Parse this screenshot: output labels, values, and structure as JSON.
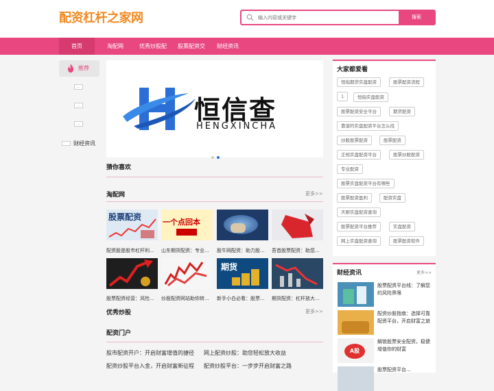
{
  "header": {
    "logo": "配资杠杆之家网",
    "search_placeholder": "输入内容或关键字",
    "search_button": "搜索"
  },
  "nav": {
    "items": [
      "首页",
      "淘配网",
      "优秀炒股配",
      "股票配资交",
      "财经资讯"
    ]
  },
  "left": {
    "recommend": "推荐",
    "dots": [
      "...",
      "...",
      "..."
    ],
    "finance": "财经资讯"
  },
  "banner": {
    "brand_cn": "恒信查",
    "brand_en": "HENGXINCHA"
  },
  "main": {
    "guess_title": "猜你喜欢",
    "tao_title": "淘配网",
    "tao_more": "更多>>",
    "grid_row1": [
      {
        "caption": "配资股是股市杠杆利...",
        "img_text": "股票配资"
      },
      {
        "caption": "山东期货配资：专业...",
        "img_text": "一个点回本"
      },
      {
        "caption": "股牛网配资：助力股...",
        "img_text": ""
      },
      {
        "caption": "吾首股票配资：助您...",
        "img_text": ""
      }
    ],
    "grid_row2": [
      {
        "caption": "股票配资经营：风险...",
        "img_text": ""
      },
      {
        "caption": "炒股配资网站助你转...",
        "img_text": ""
      },
      {
        "caption": "新手小白必看：股票...",
        "img_text": "期货"
      },
      {
        "caption": "期货配资：杠杆放大...",
        "img_text": ""
      }
    ],
    "youxiu_title": "优秀炒股",
    "youxiu_more": "更多>>",
    "portal_title": "配资门户",
    "portal_links": [
      "股市配资开户：开启财富增值的捷径",
      "网上配资炒股：助您轻松放大收益",
      "配资炒股平台入金，开启财富新征程",
      "配资炒股平台：一步步开启财富之路"
    ]
  },
  "right": {
    "title": "大家都爱看",
    "tags": [
      "恒指期货实盘配资",
      "股票配资流程",
      "1",
      "恒指实盘配资",
      "股票配资安全平台",
      "期货配资",
      "靠谱的实盘配资平台怎么找",
      "炒股股票配资",
      "股票配资",
      "正规实盘配资平台",
      "股票炒股配资",
      "专业配资",
      "股票实盘配资平台有哪些",
      "股票配资盈利",
      "配资实盘",
      "天眼实盘配资查询",
      "股票配资平台推荐",
      "实盘配资",
      "网上实盘配资查询",
      "股票配资软件"
    ],
    "finance_title": "财经资讯",
    "finance_more": "更多>>",
    "finance_items": [
      "股票配资平台线：了解您的风险界限",
      "配资炒股指南：选择可靠配资平台，开启财富之旅",
      "解锁股票安全配资，稳健增值你的财富",
      "股票配资平台..."
    ],
    "finance_img_text": [
      "",
      "",
      "A股",
      ""
    ]
  },
  "colors": {
    "accent": "#e8477f",
    "logo": "#f08a22"
  }
}
